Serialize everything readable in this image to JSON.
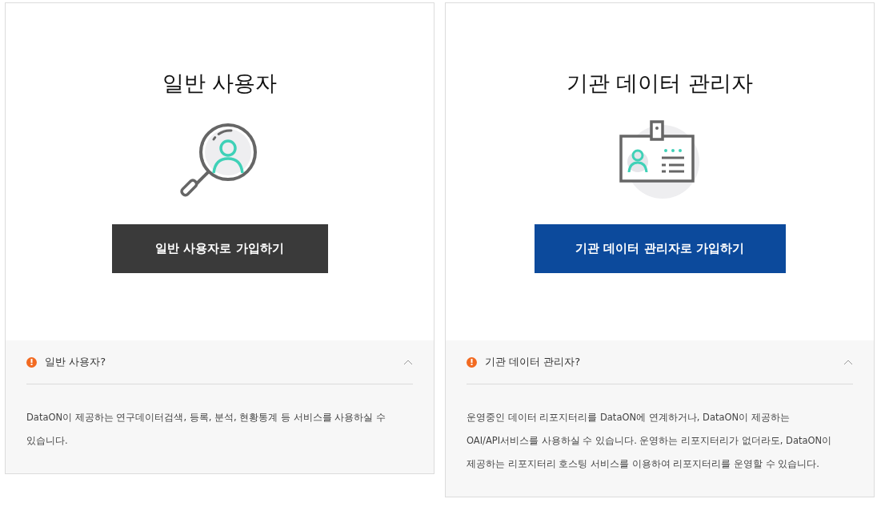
{
  "cards": [
    {
      "kind": "general",
      "title": "일반 사용자",
      "button": "일반 사용자로 가입하기",
      "info": {
        "title": "일반 사용자?",
        "expanded": true,
        "lines": [
          "DataON이 제공하는 연구데이터검색, 등록, 분석, 현황통계 등 서비스를 사용하실 수",
          "있습니다."
        ]
      }
    },
    {
      "kind": "institution",
      "title": "기관 데이터 관리자",
      "button": "기관 데이터 관리자로 가입하기",
      "info": {
        "title": "기관 데이터 관리자?",
        "expanded": true,
        "lines": [
          "운영중인 데이터 리포지터리를 DataON에 연계하거나, DataON이 제공하는",
          "OAI/API서비스를 사용하실 수 있습니다. 운영하는 리포지터리가 없더라도, DataON이",
          "제공하는 리포지터리 호스팅 서비스를 이용하여 리포지터리를 운영할 수 있습니다."
        ]
      }
    }
  ]
}
